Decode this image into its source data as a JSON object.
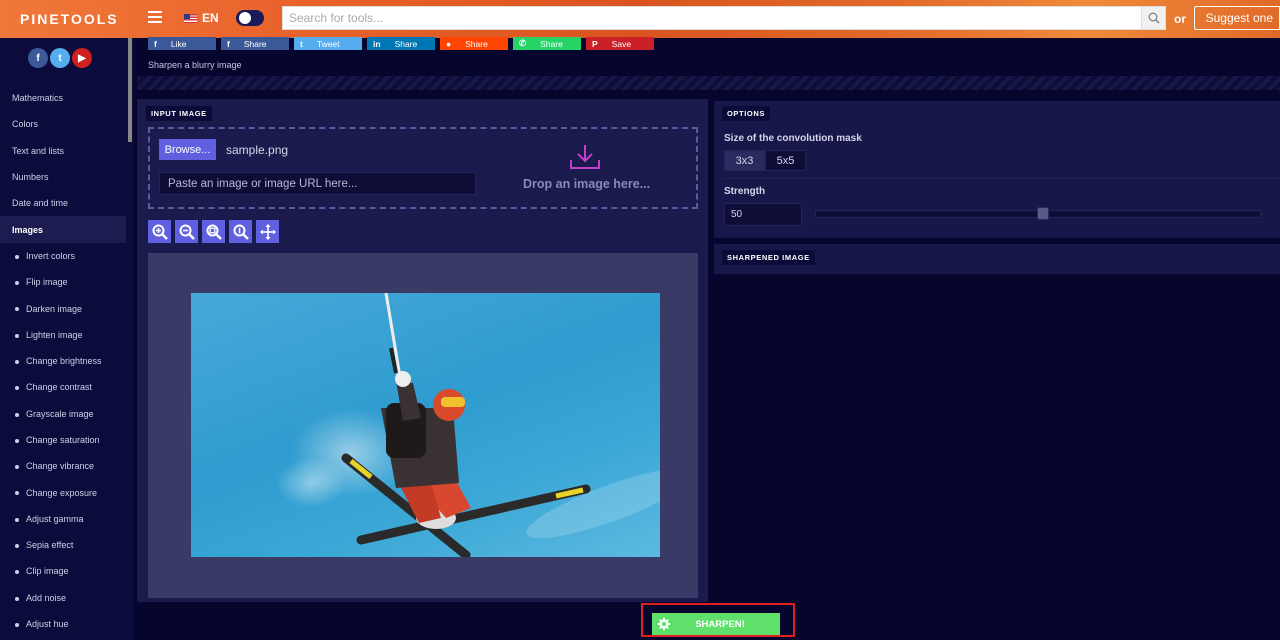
{
  "header": {
    "logo": "PINETOOLS",
    "language": "EN",
    "search_placeholder": "Search for tools...",
    "or_label": "or",
    "suggest_label": "Suggest one",
    "colors": {
      "bar": "#e8612a",
      "accent": "#5f5fe0"
    }
  },
  "sidebar": {
    "social": [
      {
        "icon": "facebook-icon",
        "glyph": "f",
        "color": "#3b5998"
      },
      {
        "icon": "twitter-icon",
        "glyph": "t",
        "color": "#55acee"
      },
      {
        "icon": "youtube-icon",
        "glyph": "▶",
        "color": "#cd201f"
      }
    ],
    "categories": [
      {
        "label": "Mathematics",
        "active": false,
        "sub": false
      },
      {
        "label": "Colors",
        "active": false,
        "sub": false
      },
      {
        "label": "Text and lists",
        "active": false,
        "sub": false
      },
      {
        "label": "Numbers",
        "active": false,
        "sub": false
      },
      {
        "label": "Date and time",
        "active": false,
        "sub": false
      },
      {
        "label": "Images",
        "active": true,
        "sub": false
      },
      {
        "label": "Invert colors",
        "active": false,
        "sub": true
      },
      {
        "label": "Flip image",
        "active": false,
        "sub": true
      },
      {
        "label": "Darken image",
        "active": false,
        "sub": true
      },
      {
        "label": "Lighten image",
        "active": false,
        "sub": true
      },
      {
        "label": "Change brightness",
        "active": false,
        "sub": true
      },
      {
        "label": "Change contrast",
        "active": false,
        "sub": true
      },
      {
        "label": "Grayscale image",
        "active": false,
        "sub": true
      },
      {
        "label": "Change saturation",
        "active": false,
        "sub": true
      },
      {
        "label": "Change vibrance",
        "active": false,
        "sub": true
      },
      {
        "label": "Change exposure",
        "active": false,
        "sub": true
      },
      {
        "label": "Adjust gamma",
        "active": false,
        "sub": true
      },
      {
        "label": "Sepia effect",
        "active": false,
        "sub": true
      },
      {
        "label": "Clip image",
        "active": false,
        "sub": true
      },
      {
        "label": "Add noise",
        "active": false,
        "sub": true
      },
      {
        "label": "Adjust hue",
        "active": false,
        "sub": true
      }
    ]
  },
  "share_buttons": [
    {
      "label": "Like",
      "icon": "facebook-icon",
      "glyph": "f",
      "color": "#3b5998"
    },
    {
      "label": "Share",
      "icon": "facebook-icon",
      "glyph": "f",
      "color": "#3b5998"
    },
    {
      "label": "Tweet",
      "icon": "twitter-icon",
      "glyph": "t",
      "color": "#55acee"
    },
    {
      "label": "Share",
      "icon": "linkedin-icon",
      "glyph": "in",
      "color": "#0077b5"
    },
    {
      "label": "Share",
      "icon": "reddit-icon",
      "glyph": "●",
      "color": "#ff4500"
    },
    {
      "label": "Share",
      "icon": "whatsapp-icon",
      "glyph": "✆",
      "color": "#25d366"
    },
    {
      "label": "Save",
      "icon": "pinterest-icon",
      "glyph": "P",
      "color": "#cb2027"
    }
  ],
  "page": {
    "subtitle": "Sharpen a blurry image"
  },
  "input": {
    "tag": "INPUT IMAGE",
    "browse_label": "Browse...",
    "filename": "sample.png",
    "url_placeholder": "Paste an image or image URL here...",
    "drop_text": "Drop an image here...",
    "zoom_tools": [
      "zoom-in-icon",
      "zoom-out-icon",
      "zoom-fit-icon",
      "zoom-reset-icon",
      "move-icon"
    ]
  },
  "options": {
    "tag": "OPTIONS",
    "mask_label": "Size of the convolution mask",
    "mask_options": [
      "3x3",
      "5x5"
    ],
    "mask_selected": "3x3",
    "strength_label": "Strength",
    "strength_value": "50",
    "strength_fraction": 0.5
  },
  "output": {
    "tag": "SHARPENED IMAGE"
  },
  "action": {
    "sharpen_label": "SHARPEN!",
    "color": "#5ee06a"
  }
}
